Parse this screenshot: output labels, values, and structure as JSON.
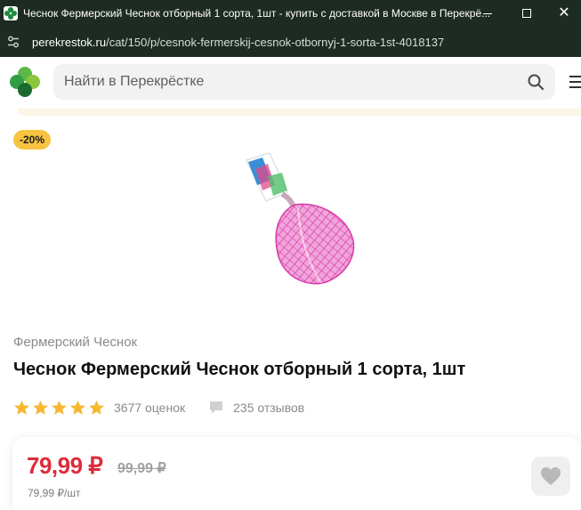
{
  "window": {
    "title": "Чеснок Фермерский Чеснок отборный 1 сорта, 1шт - купить с доставкой в Москве в Перекрё..."
  },
  "addressbar": {
    "domain": "perekrestok.ru",
    "path": "/cat/150/p/cesnok-fermerskij-cesnok-otbornyj-1-sorta-1st-4018137"
  },
  "header": {
    "search_placeholder": "Найти в Перекрёстке"
  },
  "product": {
    "discount_badge": "-20%",
    "brand": "Фермерский Чеснок",
    "title": "Чеснок Фермерский Чеснок отборный 1 сорта, 1шт",
    "rating_stars": 5,
    "ratings_count": "3677 оценок",
    "reviews_count": "235 отзывов"
  },
  "price": {
    "current": "79,99 ₽",
    "old": "99,99 ₽",
    "per_unit": "79,99 ₽/шт"
  },
  "colors": {
    "accent_price": "#dc2d3c",
    "badge": "#f7c441",
    "brand_green": "#1f8a3d",
    "star": "#f7b731"
  }
}
